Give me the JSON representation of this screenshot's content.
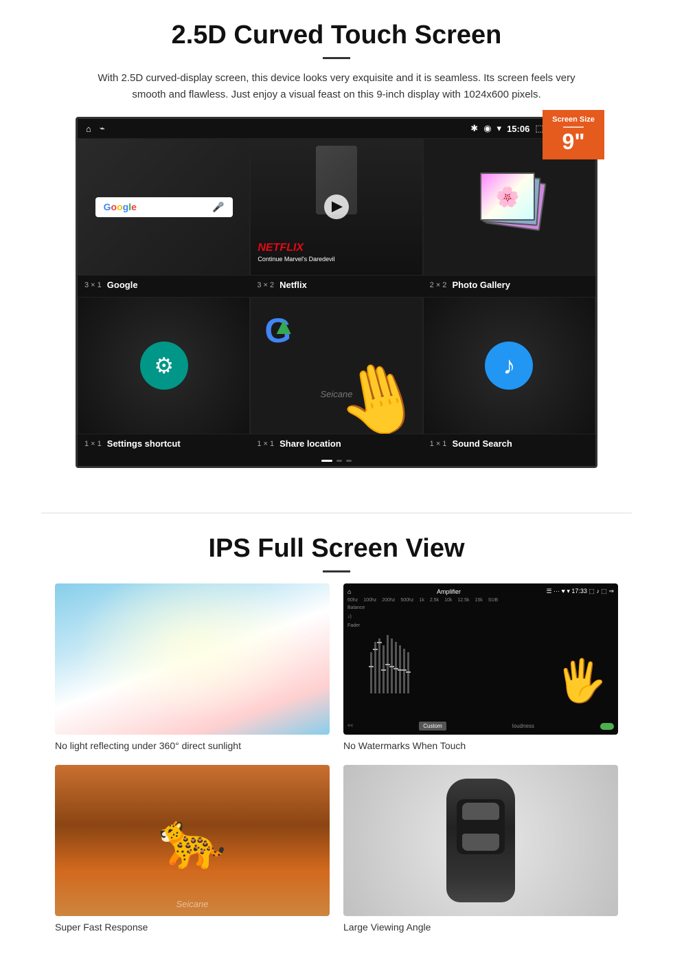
{
  "section1": {
    "title": "2.5D Curved Touch Screen",
    "description": "With 2.5D curved-display screen, this device looks very exquisite and it is seamless. Its screen feels very smooth and flawless. Just enjoy a visual feast on this 9-inch display with 1024x600 pixels.",
    "badge": {
      "label": "Screen Size",
      "size": "9\""
    },
    "statusbar": {
      "time": "15:06"
    },
    "apps": {
      "row1": [
        {
          "name": "Google",
          "dims": "3 × 1"
        },
        {
          "name": "Netflix",
          "dims": "3 × 2"
        },
        {
          "name": "Photo Gallery",
          "dims": "2 × 2"
        }
      ],
      "row2": [
        {
          "name": "Settings shortcut",
          "dims": "1 × 1"
        },
        {
          "name": "Share location",
          "dims": "1 × 1"
        },
        {
          "name": "Sound Search",
          "dims": "1 × 1"
        }
      ]
    },
    "netflix": {
      "logo": "NETFLIX",
      "subtitle": "Continue Marvel's Daredevil"
    },
    "seicane": "Seicane"
  },
  "section2": {
    "title": "IPS Full Screen View",
    "features": [
      {
        "label": "No light reflecting under 360° direct sunlight",
        "type": "sky"
      },
      {
        "label": "No Watermarks When Touch",
        "type": "equalizer"
      },
      {
        "label": "Super Fast Response",
        "type": "cheetah"
      },
      {
        "label": "Large Viewing Angle",
        "type": "car"
      }
    ]
  }
}
